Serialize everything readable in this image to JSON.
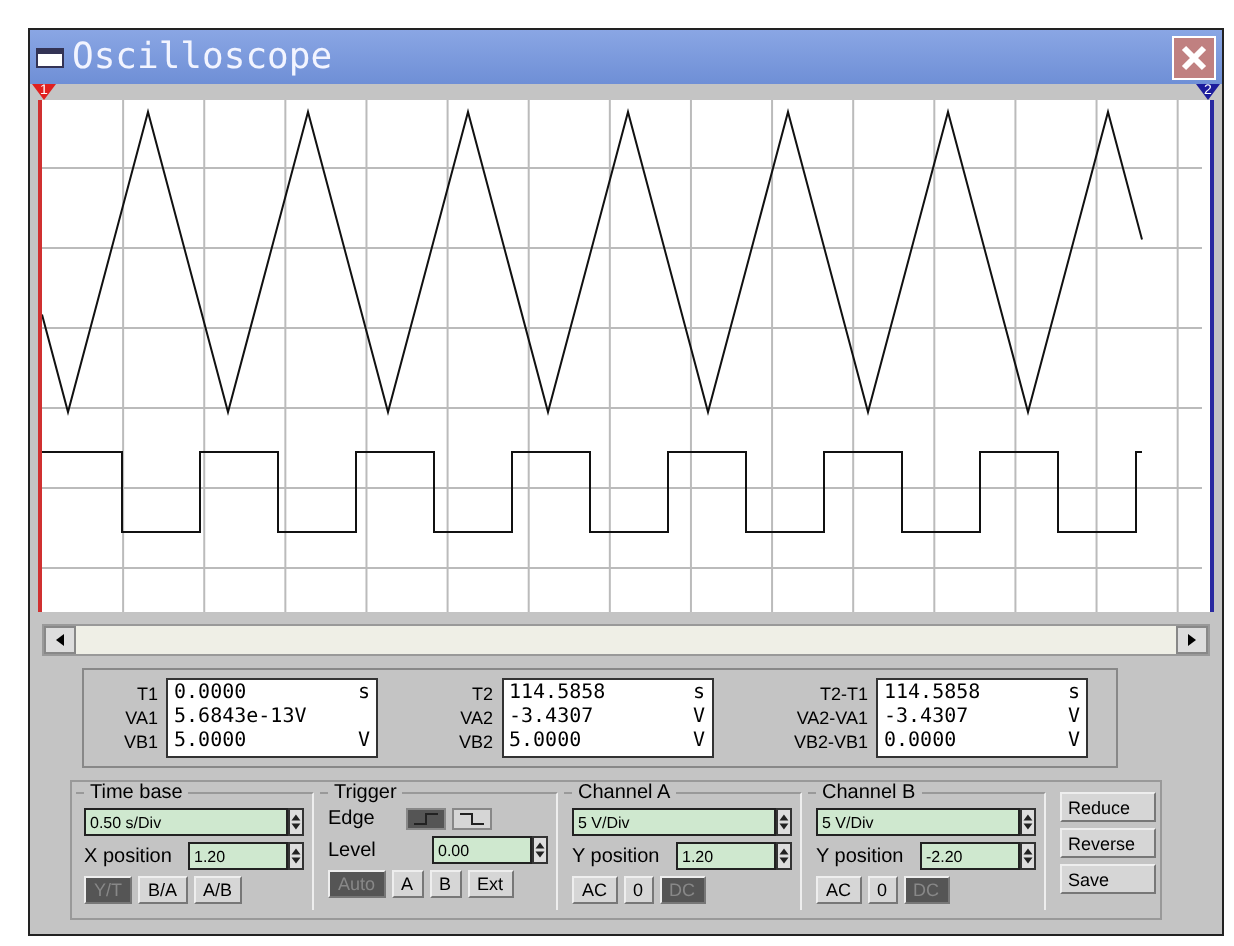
{
  "window": {
    "title": "Oscilloscope"
  },
  "cursors": [
    {
      "label": "1",
      "color": "#e02020"
    },
    {
      "label": "2",
      "color": "#1c1c9c"
    }
  ],
  "readouts": [
    {
      "rows": [
        {
          "label": "T1",
          "value": "0.0000",
          "unit": "s"
        },
        {
          "label": "VA1",
          "value": "5.6843e-13V"
        },
        {
          "label": "VB1",
          "value": "5.0000",
          "unit": "V"
        }
      ]
    },
    {
      "rows": [
        {
          "label": "T2",
          "value": "114.5858",
          "unit": "s"
        },
        {
          "label": "VA2",
          "value": "-3.4307",
          "unit": "V"
        },
        {
          "label": "VB2",
          "value": "5.0000",
          "unit": "V"
        }
      ]
    },
    {
      "rows": [
        {
          "label": "T2-T1",
          "value": "114.5858",
          "unit": "s"
        },
        {
          "label": "VA2-VA1",
          "value": "-3.4307",
          "unit": "V"
        },
        {
          "label": "VB2-VB1",
          "value": "0.0000",
          "unit": "V"
        }
      ]
    }
  ],
  "time_base": {
    "title": "Time base",
    "scale": "0.50 s/Div",
    "x_position": {
      "label": "X position",
      "value": "1.20"
    },
    "modes": [
      {
        "label": "Y/T",
        "selected": true
      },
      {
        "label": "B/A",
        "selected": false
      },
      {
        "label": "A/B",
        "selected": false
      }
    ]
  },
  "trigger": {
    "title": "Trigger",
    "edge": {
      "label": "Edge",
      "options": [
        {
          "kind": "rising",
          "selected": true
        },
        {
          "kind": "falling",
          "selected": false
        }
      ]
    },
    "level": {
      "label": "Level",
      "value": "0.00"
    },
    "sources": [
      {
        "label": "Auto",
        "selected": true
      },
      {
        "label": "A",
        "selected": false
      },
      {
        "label": "B",
        "selected": false
      },
      {
        "label": "Ext",
        "selected": false
      }
    ]
  },
  "channels": [
    {
      "title": "Channel A",
      "scale": "5 V/Div",
      "y_position": {
        "label": "Y position",
        "value": "1.20"
      },
      "coupling": [
        {
          "label": "AC",
          "selected": false
        },
        {
          "label": "0",
          "selected": false
        },
        {
          "label": "DC",
          "selected": true
        }
      ]
    },
    {
      "title": "Channel B",
      "scale": "5 V/Div",
      "y_position": {
        "label": "Y position",
        "value": "-2.20"
      },
      "coupling": [
        {
          "label": "AC",
          "selected": false
        },
        {
          "label": "0",
          "selected": false
        },
        {
          "label": "DC",
          "selected": true
        }
      ]
    }
  ],
  "buttons": [
    "Reduce",
    "Reverse",
    "Save"
  ]
}
